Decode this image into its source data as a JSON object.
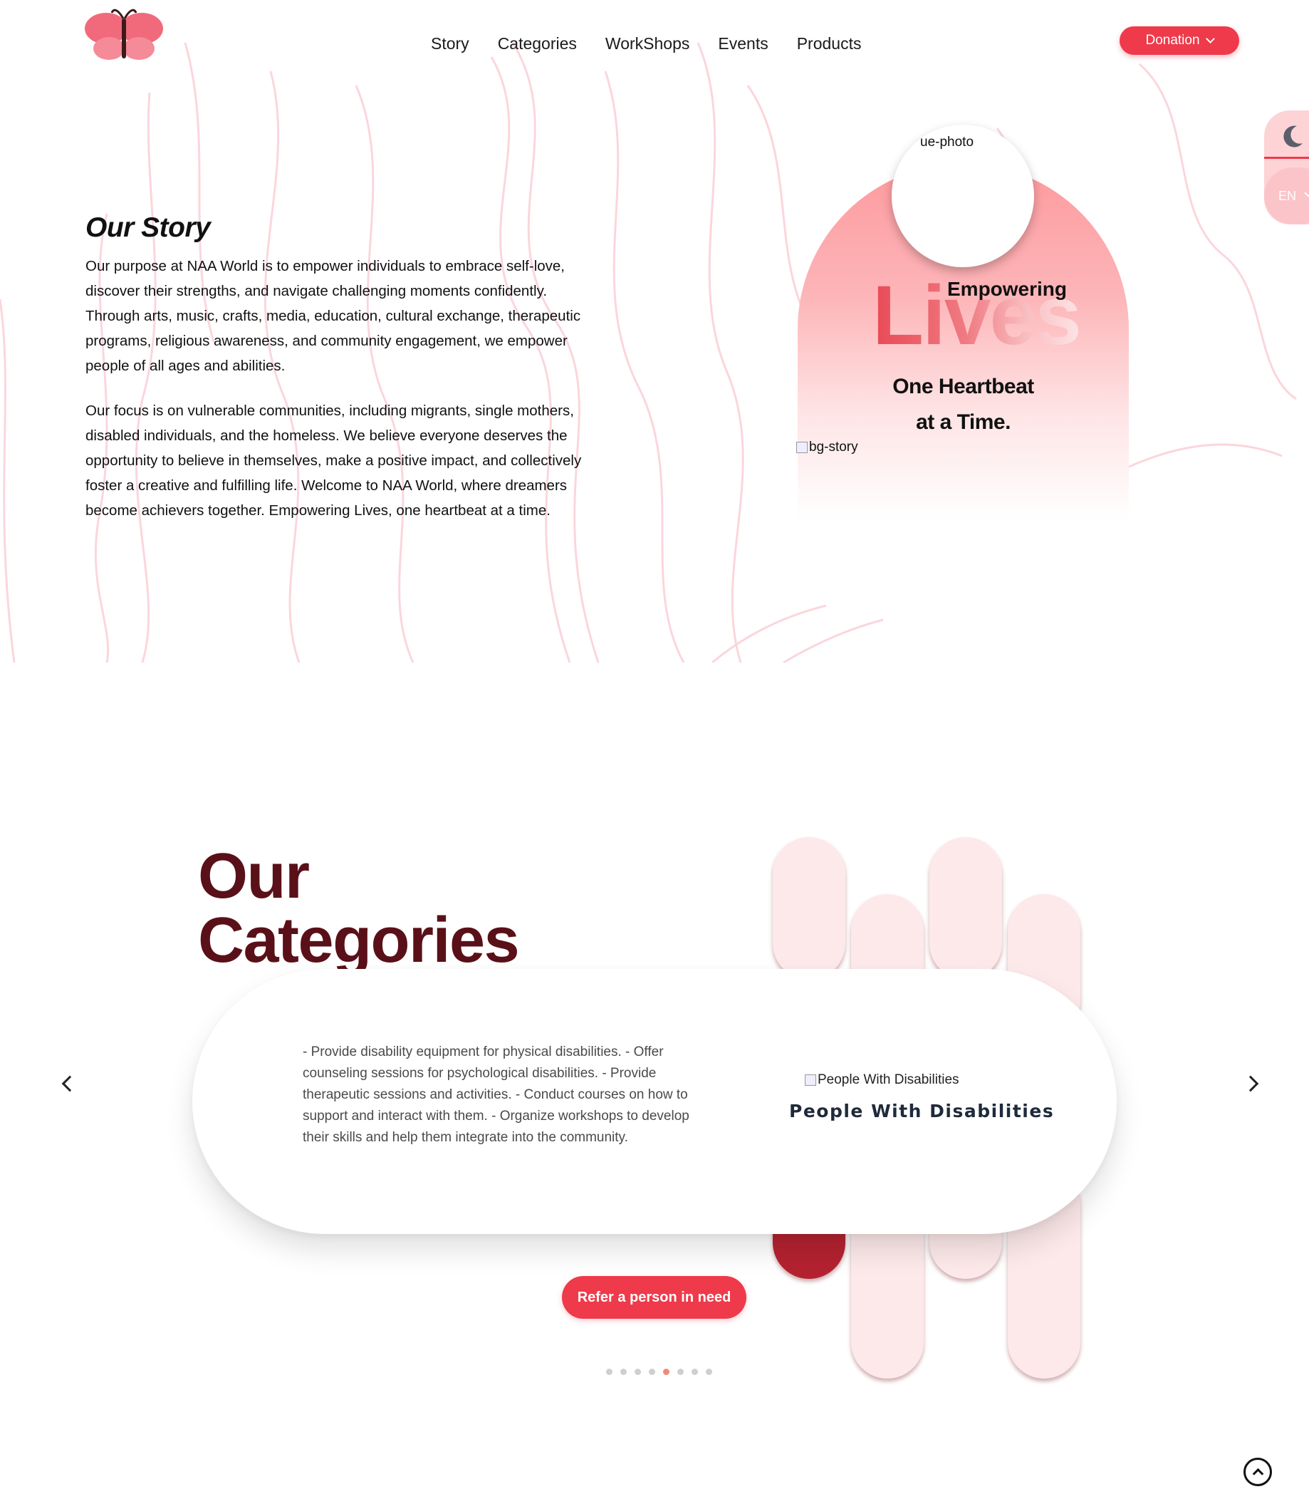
{
  "nav": {
    "items": [
      "Story",
      "Categories",
      "WorkShops",
      "Events",
      "Products"
    ],
    "donation_label": "Donation"
  },
  "side_toggle": {
    "language": "EN"
  },
  "story": {
    "title": "Our Story",
    "paragraph_1": "Our purpose at NAA World is to empower individuals to embrace self-love, discover their strengths, and navigate challenging moments confidently. Through arts, music, crafts, media, education, cultural exchange, therapeutic programs, religious awareness, and community engagement, we empower people of all ages and abilities.",
    "paragraph_2": "Our focus is on vulnerable communities, including migrants, single mothers, disabled individuals, and the homeless. We believe everyone deserves the opportunity to believe in themselves, make a positive impact, and collectively foster a creative and fulfilling life. Welcome to NAA World, where dreamers become achievers together. Empowering Lives, one heartbeat at a time.",
    "photo_alt": "ue-photo",
    "tagline_top": "Empowering",
    "tagline_big": "Lives",
    "tagline_line1": "One Heartbeat",
    "tagline_line2": "at a Time.",
    "bg_alt": "bg-story"
  },
  "categories": {
    "title_line1": "Our",
    "title_line2": "Categories",
    "current": {
      "description": "- Provide disability equipment for physical disabilities. - Offer counseling sessions for psychological disabilities. - Provide therapeutic sessions and activities. - Conduct courses on how to support and interact with them. - Organize workshops to develop their skills and help them integrate into the community.",
      "image_alt": "People With Disabilities",
      "name": "People With Disabilities"
    },
    "refer_label": "Refer a person in need",
    "slide_count": 8,
    "active_slide": 5
  },
  "colors": {
    "accent": "#ee3a4a",
    "title_dark": "#5a1018",
    "pill_light": "#fde9ea",
    "pill_dark": "#b42230"
  },
  "icons": [
    "butterfly-logo",
    "moon-icon",
    "chevron-down-icon",
    "chevron-left-icon",
    "chevron-right-icon",
    "scroll-top-icon"
  ]
}
